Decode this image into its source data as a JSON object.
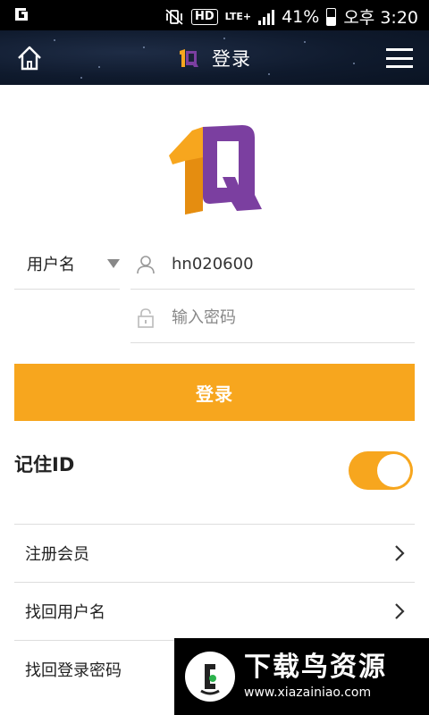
{
  "status_bar": {
    "battery": "41%",
    "time": "오후 3:20",
    "hd": "HD",
    "network": "LTE+"
  },
  "header": {
    "title": "登录"
  },
  "form": {
    "id_type": "用户名",
    "username_value": "hn020600",
    "password_placeholder": "输入密码",
    "login_button": "登录"
  },
  "remember": {
    "label": "记住ID",
    "enabled": true
  },
  "links": [
    {
      "label": "注册会员"
    },
    {
      "label": "找回用户名"
    },
    {
      "label": "找回登录密码"
    }
  ],
  "watermark": {
    "title": "下载鸟资源",
    "url": "www.xiazainiao.com"
  },
  "colors": {
    "accent": "#f7a61e",
    "header_bg": "#0f1a2d",
    "logo_orange": "#f7a61e",
    "logo_purple": "#7b3fa0"
  }
}
